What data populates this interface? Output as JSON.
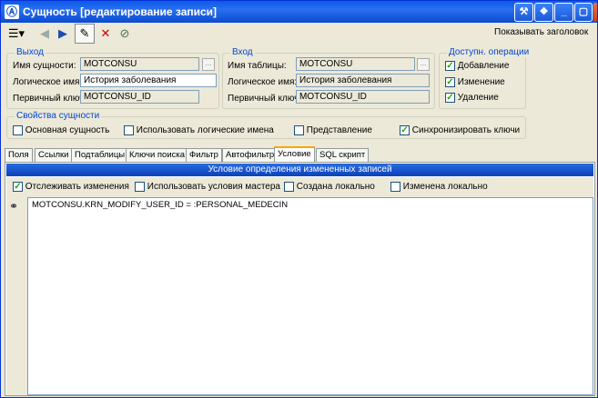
{
  "window": {
    "title": "Сущность [редактирование записи]",
    "app_icon": "app-icon",
    "buttons": {
      "tools_icon": "wrench-icon",
      "help_icon": "help-icon",
      "minimize_icon": "minimize-icon",
      "maximize_icon": "maximize-icon",
      "close_icon": "close-icon"
    }
  },
  "toolbar": {
    "menu_icon": "menu-list-icon",
    "back_icon": "arrow-left-icon",
    "forward_icon": "arrow-right-icon",
    "edit_icon": "pencil-icon",
    "delete_icon": "delete-doc-icon",
    "cancel_icon": "cancel-doc-icon",
    "show_header_label": "Показывать заголовок",
    "show_header_checked": true
  },
  "output_group": {
    "title": "Выход",
    "entity_name_label": "Имя сущности:",
    "entity_name_value": "MOTCONSU",
    "logical_name_label": "Логическое имя:",
    "logical_name_value": "История заболевания",
    "primary_key_label": "Первичный ключ:",
    "primary_key_value": "MOTCONSU_ID"
  },
  "input_group": {
    "title": "Вход",
    "table_name_label": "Имя таблицы:",
    "table_name_value": "MOTCONSU",
    "logical_name_label": "Логическое имя:",
    "logical_name_value": "История заболевания",
    "primary_key_label": "Первичный ключ:",
    "primary_key_value": "MOTCONSU_ID"
  },
  "ops_group": {
    "title": "Доступн. операции",
    "items": [
      {
        "label": "Добавление",
        "checked": true
      },
      {
        "label": "Изменение",
        "checked": true
      },
      {
        "label": "Удаление",
        "checked": true
      }
    ]
  },
  "props_group": {
    "title": "Свойства сущности",
    "items": [
      {
        "label": "Основная сущность",
        "checked": false
      },
      {
        "label": "Использовать логические имена",
        "checked": false
      },
      {
        "label": "Представление",
        "checked": false
      },
      {
        "label": "Синхронизировать ключи",
        "checked": true
      }
    ]
  },
  "tabs": [
    {
      "label": "Поля"
    },
    {
      "label": "Ссылки"
    },
    {
      "label": "Подтаблицы"
    },
    {
      "label": "Ключи поиска"
    },
    {
      "label": "Фильтр"
    },
    {
      "label": "Автофильтр"
    },
    {
      "label": "Условие",
      "active": true
    },
    {
      "label": "SQL скрипт"
    }
  ],
  "condition_panel": {
    "header": "Условие определения измененных записей",
    "options": [
      {
        "label": "Отслеживать изменения",
        "checked": true
      },
      {
        "label": "Использовать условия мастера",
        "checked": false
      },
      {
        "label": "Создана локально",
        "checked": false
      },
      {
        "label": "Изменена локально",
        "checked": false
      }
    ],
    "binoculars_icon": "binoculars-icon",
    "condition_text": "MOTCONSU.KRN_MODIFY_USER_ID = :PERSONAL_MEDECIN"
  },
  "colors": {
    "titlebar": "#0a5ce8",
    "group_title": "#0046d5",
    "panel_header": "#2a6ae0",
    "active_tab_accent": "#f9a602",
    "check_mark": "#21a121"
  }
}
